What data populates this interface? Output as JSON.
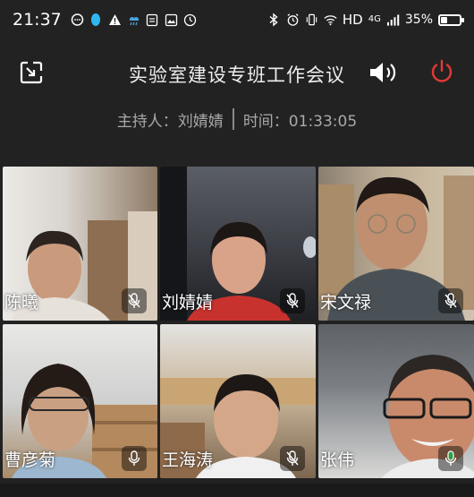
{
  "status_bar": {
    "time": "21:37",
    "network": "4G",
    "hd": "HD",
    "battery": "35%",
    "battery_level": 0.35,
    "left_icons": [
      "message-bubble-icon",
      "qq-penguin-icon",
      "warning-icon",
      "weather-icon",
      "sim-icon",
      "gallery-icon",
      "clock-badge-icon"
    ],
    "right_icons": [
      "bluetooth-icon",
      "alarm-icon",
      "vibrate-icon",
      "wifi-icon",
      "signal-icon"
    ]
  },
  "header": {
    "title": "实验室建设专班工作会议",
    "power_color": "#e53935"
  },
  "meeting": {
    "host": "主持人：刘婧婧",
    "time": "时间：01:33:05"
  },
  "participants": [
    {
      "name": "陈曦",
      "mic": "muted"
    },
    {
      "name": "刘婧婧",
      "mic": "muted"
    },
    {
      "name": "宋文禄",
      "mic": "muted"
    },
    {
      "name": "曹彦菊",
      "mic": "on"
    },
    {
      "name": "王海涛",
      "mic": "muted"
    },
    {
      "name": "张伟",
      "mic": "active",
      "mic_color": "#2ea043"
    }
  ]
}
